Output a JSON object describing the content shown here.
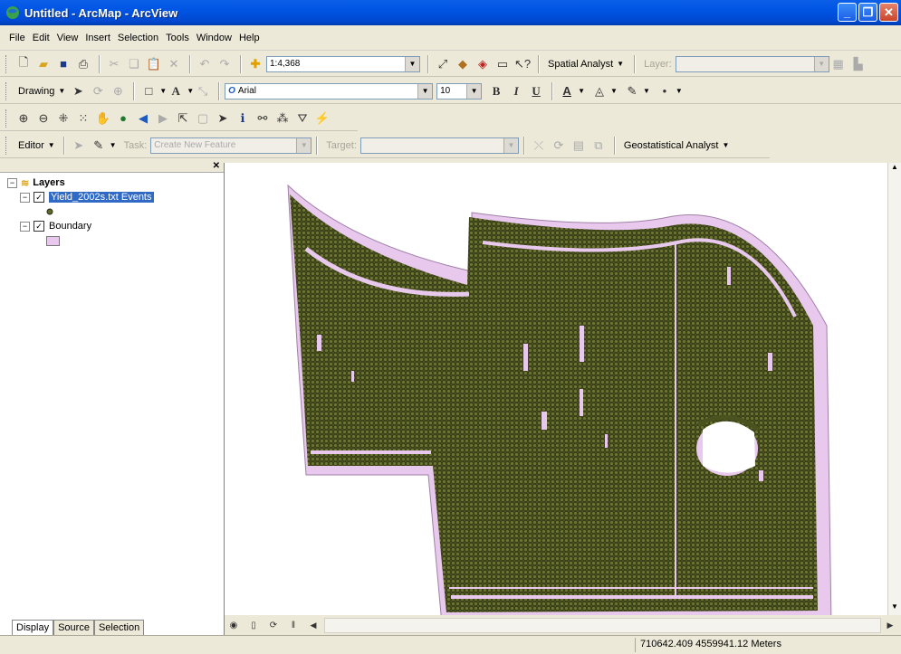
{
  "window": {
    "title": "Untitled - ArcMap - ArcView"
  },
  "menu": [
    "File",
    "Edit",
    "View",
    "Insert",
    "Selection",
    "Tools",
    "Window",
    "Help"
  ],
  "standard_toolbar": {
    "scale": "1:4,368",
    "spatial_analyst": "Spatial Analyst",
    "layer_label": "Layer:",
    "layer_value": ""
  },
  "drawing_toolbar": {
    "drawing_label": "Drawing",
    "font": "Arial",
    "font_size": "10",
    "bold": "B",
    "italic": "I",
    "underline": "U"
  },
  "editor_toolbar": {
    "editor_label": "Editor",
    "task_label": "Task:",
    "task_value": "Create New Feature",
    "target_label": "Target:",
    "geostat": "Geostatistical Analyst"
  },
  "toc": {
    "root": "Layers",
    "layers": [
      {
        "name": "Yield_2002s.txt Events",
        "checked": true
      },
      {
        "name": "Boundary",
        "checked": true
      }
    ],
    "tabs": [
      "Display",
      "Source",
      "Selection"
    ]
  },
  "map": {
    "boundary_fill": "#e8c8ec",
    "point_fill": "#5f6a2a",
    "point_edge": "#2a2a10"
  },
  "status": {
    "coordinates": "710642.409  4559941.12 Meters"
  }
}
